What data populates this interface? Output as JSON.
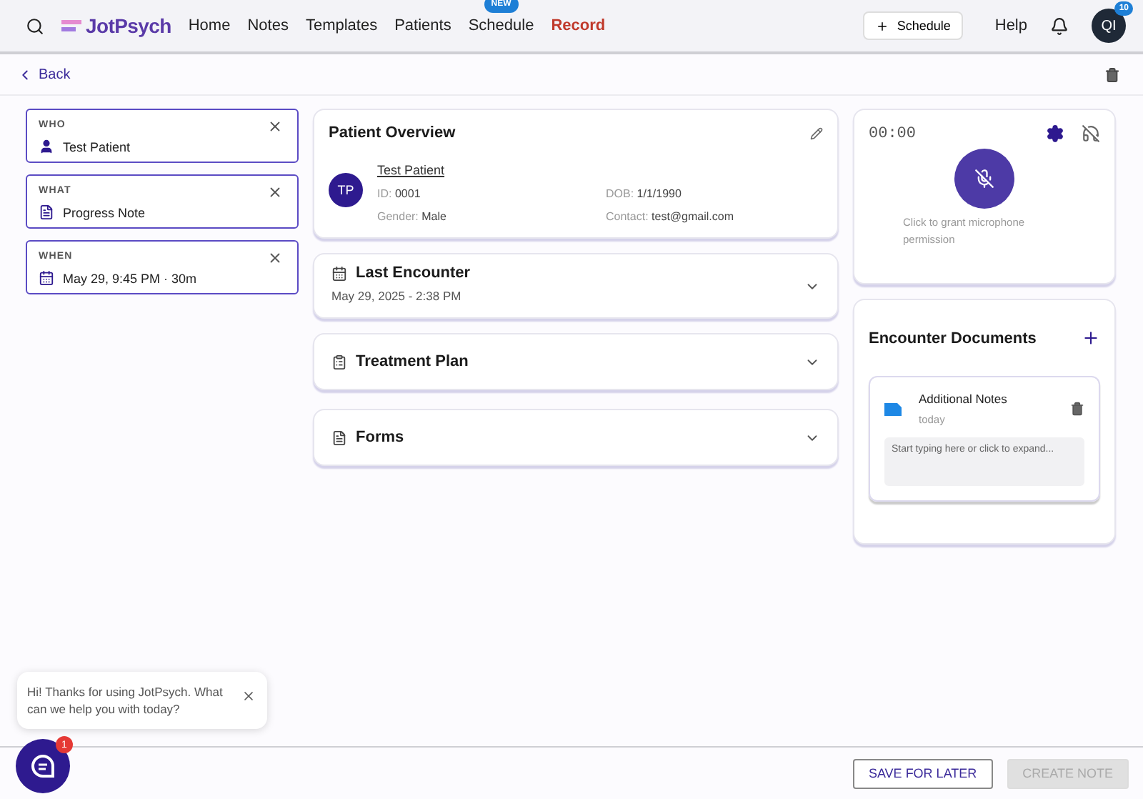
{
  "nav": {
    "brand": "JotPsych",
    "items": [
      {
        "label": "Home",
        "selected": false
      },
      {
        "label": "Notes",
        "selected": false
      },
      {
        "label": "Templates",
        "selected": false
      },
      {
        "label": "Patients",
        "selected": false
      },
      {
        "label": "Schedule",
        "selected": false,
        "badge": "NEW"
      },
      {
        "label": "Record",
        "selected": true
      }
    ],
    "schedule_button": "Schedule",
    "help": "Help",
    "avatar": "QI",
    "avatar_badge": "10"
  },
  "back": "Back",
  "fields": [
    {
      "label": "WHO",
      "value": "Test Patient",
      "kind": "person"
    },
    {
      "label": "WHAT",
      "value": "Progress Note",
      "kind": "document"
    },
    {
      "label": "WHEN",
      "value": "May 29, 9:45 PM · 30m",
      "kind": "calendar"
    }
  ],
  "overview": {
    "title": "Patient Overview",
    "initials": "TP",
    "name": "Test Patient",
    "details": [
      {
        "label": "ID:",
        "value": "0001"
      },
      {
        "label": "DOB:",
        "value": "1/1/1990"
      },
      {
        "label": "Gender:",
        "value": "Male"
      },
      {
        "label": "Contact:",
        "value": "test@gmail.com"
      }
    ]
  },
  "sections": [
    {
      "title": "Last Encounter",
      "subtitle": "May 29, 2025 - 2:38 PM",
      "kind": "calendar",
      "expanded": false
    },
    {
      "title": "Treatment Plan",
      "kind": "clipboard",
      "expanded": false
    },
    {
      "title": "Forms",
      "kind": "document",
      "expanded": false
    }
  ],
  "recorder": {
    "timer": "00:00",
    "hint": "Click to grant microphone permission"
  },
  "documents": {
    "title": "Encounter Documents",
    "items": [
      {
        "name": "Additional Notes",
        "date": "today",
        "placeholder": "Start typing here or click to expand..."
      }
    ]
  },
  "chat": {
    "message": "Hi! Thanks for using JotPsych. What can we help you with today?",
    "badge": "1"
  },
  "footer": {
    "save": "SAVE FOR LATER",
    "create": "CREATE NOTE",
    "create_disabled": true
  }
}
